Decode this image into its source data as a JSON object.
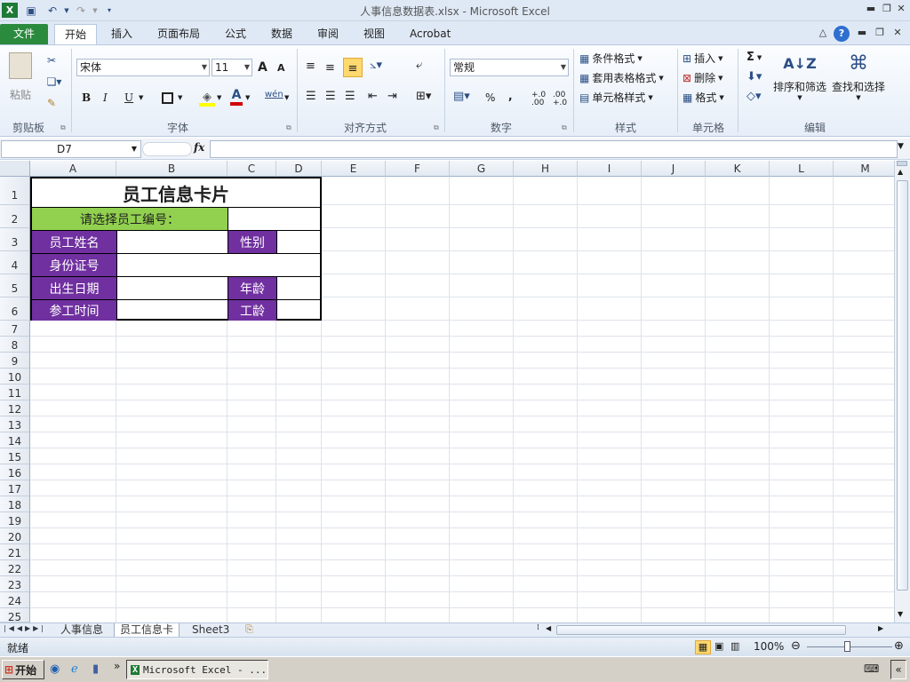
{
  "window": {
    "title": "人事信息数据表.xlsx  -  Microsoft Excel"
  },
  "ribbon_tabs": [
    "文件",
    "开始",
    "插入",
    "页面布局",
    "公式",
    "数据",
    "审阅",
    "视图",
    "Acrobat"
  ],
  "clipboard": {
    "paste": "粘贴",
    "label": "剪贴板"
  },
  "font": {
    "name": "宋体",
    "size": "11",
    "label": "字体",
    "bold": "B",
    "italic": "I",
    "underline": "U",
    "grow": "A",
    "shrink": "A",
    "color_a": "A",
    "wen": "wén"
  },
  "alignment": {
    "label": "对齐方式"
  },
  "number": {
    "format": "常规",
    "label": "数字",
    "percent": "%",
    "comma": ",",
    "inc_decimal": "+.0 .00",
    "dec_decimal": ".00 +.0"
  },
  "styles": {
    "conditional": "条件格式",
    "table_format": "套用表格格式",
    "cell_styles": "单元格样式",
    "label": "样式"
  },
  "cells": {
    "insert": "插入",
    "delete": "删除",
    "format": "格式",
    "label": "单元格"
  },
  "editing": {
    "sum": "Σ",
    "sort_filter": "排序和筛选",
    "find_select": "查找和选择",
    "label": "编辑",
    "sort_az": "A↓Z"
  },
  "formula_bar": {
    "name_box": "D7",
    "fx": "fx",
    "value": ""
  },
  "columns": [
    "A",
    "B",
    "C",
    "D",
    "E",
    "F",
    "G",
    "H",
    "I",
    "J",
    "K",
    "L",
    "M"
  ],
  "rows": [
    "1",
    "2",
    "3",
    "4",
    "5",
    "6",
    "7",
    "8",
    "9",
    "10",
    "11",
    "12",
    "13",
    "14",
    "15",
    "16",
    "17",
    "18",
    "19",
    "20",
    "21",
    "22",
    "23",
    "24",
    "25"
  ],
  "sheet": {
    "title": "员工信息卡片",
    "prompt": "请选择员工编号：",
    "name_label": "员工姓名",
    "gender_label": "性别",
    "id_label": "身份证号",
    "birth_label": "出生日期",
    "age_label": "年龄",
    "join_label": "参工时间",
    "seniority_label": "工龄"
  },
  "sheet_tabs": [
    "人事信息",
    "员工信息卡",
    "Sheet3"
  ],
  "status": {
    "ready": "就绪",
    "zoom": "100%"
  },
  "taskbar": {
    "start": "开始",
    "excel_task": "Microsoft Excel - ...",
    "chevrons": "»",
    "back": "«"
  }
}
